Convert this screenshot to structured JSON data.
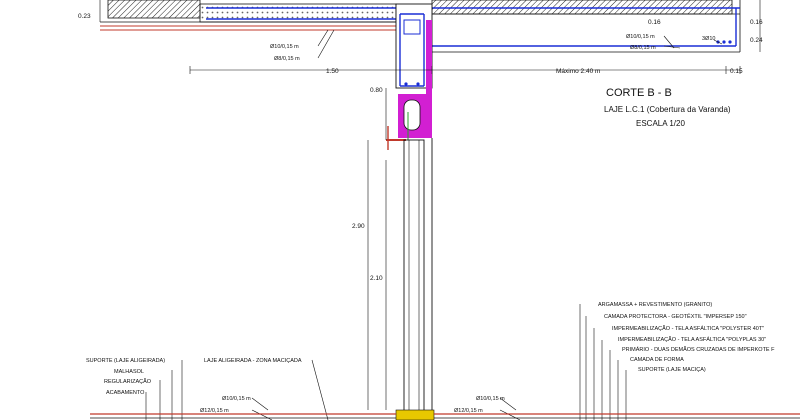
{
  "title": {
    "main": "CORTE  B - B",
    "sub": "LAJE L.C.1 (Cobertura da Varanda)",
    "scale": "ESCALA 1/20"
  },
  "dimensions": {
    "d023": "0.23",
    "d016_left": "0.16",
    "d016_right": "0.16",
    "d024": "0.24",
    "d150": "1.50",
    "d240": "Máximo 2.40 m",
    "d015": "0.15",
    "d080": "0.80",
    "d290": "2.90",
    "d210": "2.10"
  },
  "rebar_labels": {
    "top_left_1": "Ø10/0,15 m",
    "top_left_2": "Ø8/0,15 m",
    "top_right_1": "Ø10/0,15 m",
    "top_right_2": "Ø8/0,15 m",
    "top_right_3": "3Ø10",
    "bot_left_1": "Ø10/0,15 m",
    "bot_left_2": "Ø12/0,15 m",
    "bot_right_1": "Ø10/0,15 m",
    "bot_right_2": "Ø12/0,15 m"
  },
  "legend_right": [
    "ARGAMASSA + REVESTIMENTO (GRANITO)",
    "CAMADA PROTECTORA - GEOTÊXTIL \"IMPERSEP 150\"",
    "IMPERMEABILIZAÇÃO - TELA ASFÁLTICA \"POLYSTER 40T\"",
    "IMPERMEABILIZAÇÃO - TELA ASFÁLTICA \"POLYPLAS 30\"",
    "PRIMÁRIO - DUAS DEMÃOS CRUZADAS DE IMPERKOTE F",
    "CAMADA DE FORMA",
    "SUPORTE (LAJE MACIÇA)"
  ],
  "legend_left": [
    "SUPORTE (LAJE ALIGEIRADA)",
    "MALHASOL",
    "REGULARIZAÇÃO",
    "ACABAMENTO"
  ],
  "legend_left_extra": "LAJE ALIGEIRADA - ZONA MACIÇADA",
  "colors": {
    "rebar": "#1a2ed6",
    "section_fill": "#d21fd2",
    "finish_red": "#c0392b",
    "line": "#111111",
    "green_mark": "#2aa12a",
    "yellow_mark": "#e8c800"
  }
}
